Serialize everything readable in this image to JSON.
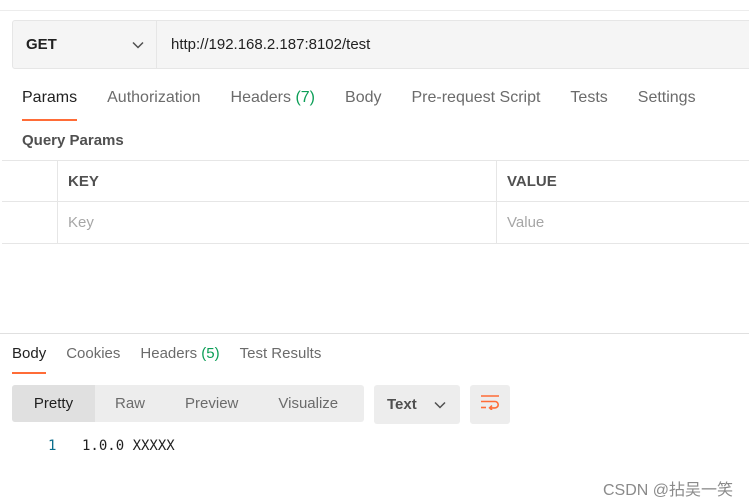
{
  "request": {
    "method": "GET",
    "url": "http://192.168.2.187:8102/test"
  },
  "tabs": [
    {
      "label": "Params"
    },
    {
      "label": "Authorization"
    },
    {
      "label": "Headers",
      "count": "(7)"
    },
    {
      "label": "Body"
    },
    {
      "label": "Pre-request Script"
    },
    {
      "label": "Tests"
    },
    {
      "label": "Settings"
    }
  ],
  "params": {
    "title": "Query Params",
    "key_header": "KEY",
    "value_header": "VALUE",
    "key_placeholder": "Key",
    "value_placeholder": "Value"
  },
  "response": {
    "tabs": [
      {
        "label": "Body"
      },
      {
        "label": "Cookies"
      },
      {
        "label": "Headers",
        "count": "(5)"
      },
      {
        "label": "Test Results"
      }
    ],
    "views": [
      "Pretty",
      "Raw",
      "Preview",
      "Visualize"
    ],
    "format": "Text",
    "line_number": "1",
    "body": "1.0.0 XXXXX"
  },
  "watermark": "CSDN @拈吴一笑",
  "colors": {
    "accent": "#ff6c37",
    "count_green": "#0c9e57"
  },
  "icons": [
    "chevron-down-icon",
    "wrap-lines-icon"
  ]
}
